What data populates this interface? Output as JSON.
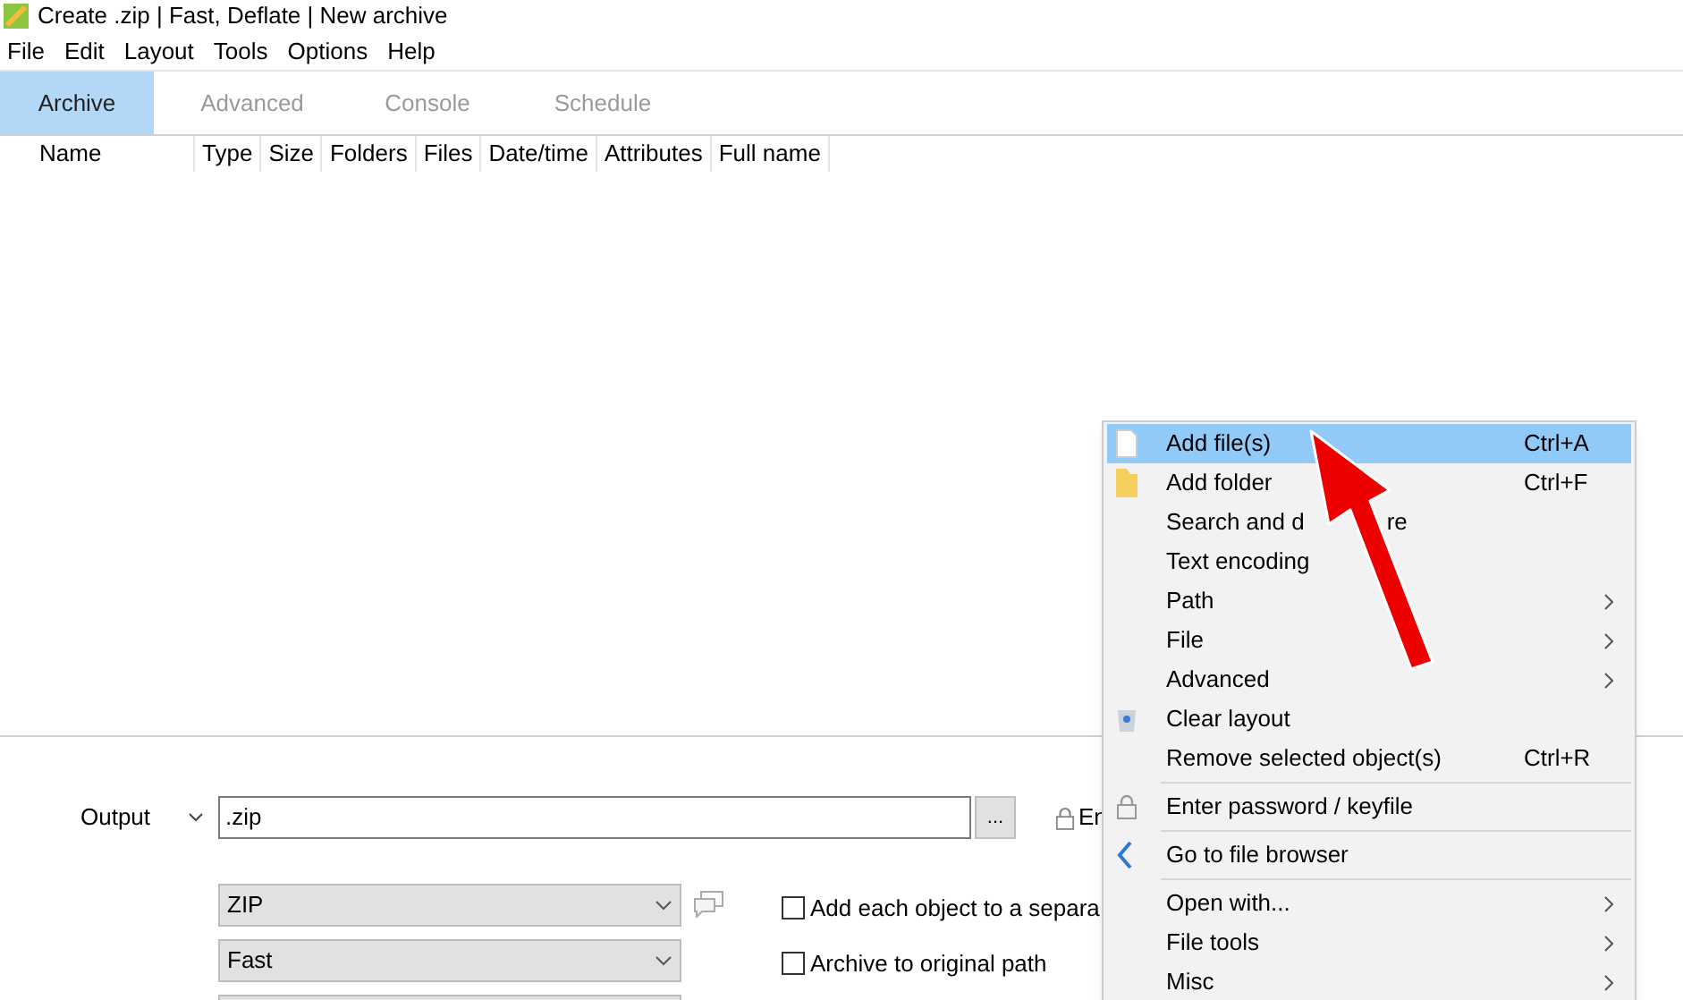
{
  "window": {
    "title": "Create .zip | Fast, Deflate | New archive"
  },
  "menu_bar": [
    "File",
    "Edit",
    "Layout",
    "Tools",
    "Options",
    "Help"
  ],
  "tabs": [
    {
      "label": "Archive",
      "selected": true
    },
    {
      "label": "Advanced",
      "selected": false
    },
    {
      "label": "Console",
      "selected": false
    },
    {
      "label": "Schedule",
      "selected": false
    }
  ],
  "table": {
    "columns": [
      "Name",
      "Type",
      "Size",
      "Folders",
      "Files",
      "Date/time",
      "Attributes",
      "Full name"
    ]
  },
  "output": {
    "label": "Output",
    "value": ".zip",
    "browse": "...",
    "encrypt_label": "En"
  },
  "format_selects": [
    {
      "kind": "dropdown",
      "value": "ZIP"
    },
    {
      "kind": "dropdown",
      "value": "Fast"
    },
    {
      "kind": "dropdown"
    }
  ],
  "options": [
    {
      "label": "Add each object to a separa",
      "checked": false
    },
    {
      "label": "Archive to original path",
      "checked": false
    }
  ],
  "context_menu": [
    {
      "kind": "item",
      "label": "Add file(s)",
      "shortcut": "Ctrl+A",
      "selected": true
    },
    {
      "kind": "item",
      "label": "Add folder",
      "shortcut": "Ctrl+F",
      "selected": false
    },
    {
      "kind": "covered",
      "label": "Search and d",
      "label_end": "re",
      "selected": false
    },
    {
      "kind": "item",
      "label": "Text encoding",
      "selected": false
    },
    {
      "kind": "item",
      "label": "Path",
      "submenu": true,
      "selected": false
    },
    {
      "kind": "item",
      "label": "File",
      "submenu": true,
      "selected": false
    },
    {
      "kind": "item",
      "label": "Advanced",
      "submenu": true,
      "selected": false
    },
    {
      "kind": "item",
      "label": "Clear layout",
      "selected": false
    },
    {
      "kind": "item",
      "label": "Remove selected object(s)",
      "shortcut": "Ctrl+R",
      "selected": false
    },
    {
      "kind": "separator"
    },
    {
      "kind": "item",
      "label": "Enter password / keyfile",
      "selected": false
    },
    {
      "kind": "separator"
    },
    {
      "kind": "item",
      "label": "Go to file browser",
      "selected": false
    },
    {
      "kind": "separator"
    },
    {
      "kind": "item",
      "label": "Open with...",
      "submenu": true,
      "selected": false
    },
    {
      "kind": "item",
      "label": "File tools",
      "submenu": true,
      "selected": false
    },
    {
      "kind": "item",
      "label": "Misc",
      "submenu": true,
      "selected": false
    }
  ]
}
